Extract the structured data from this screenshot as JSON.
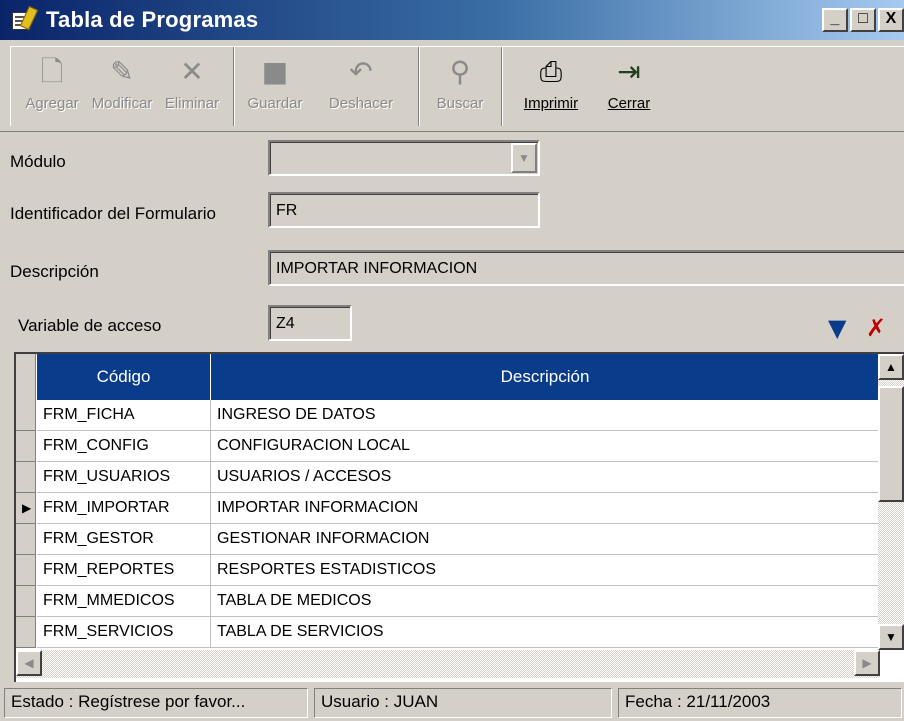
{
  "window": {
    "title": "Tabla de Programas",
    "controls": [
      "_",
      "□",
      "X"
    ]
  },
  "toolbar": {
    "agregar": "Agregar",
    "modificar": "Modificar",
    "eliminar": "Eliminar",
    "guardar": "Guardar",
    "deshacer": "Deshacer",
    "buscar": "Buscar",
    "imprimir": "Imprimir",
    "cerrar": "Cerrar"
  },
  "form": {
    "modulo_label": "Módulo",
    "modulo_value": "",
    "identificador_label": "Identificador del Formulario",
    "identificador_value": "FR",
    "descripcion_label": "Descripción",
    "descripcion_value": "IMPORTAR INFORMACION",
    "variable_label": "Variable de acceso",
    "variable_value": "Z4"
  },
  "grid": {
    "columns": [
      "Código",
      "Descripción"
    ],
    "current_row": 3,
    "rows": [
      [
        "FRM_FICHA",
        "INGRESO DE DATOS"
      ],
      [
        "FRM_CONFIG",
        "CONFIGURACION LOCAL"
      ],
      [
        "FRM_USUARIOS",
        "USUARIOS / ACCESOS"
      ],
      [
        "FRM_IMPORTAR",
        "IMPORTAR INFORMACION"
      ],
      [
        "FRM_GESTOR",
        "GESTIONAR INFORMACION"
      ],
      [
        "FRM_REPORTES",
        "RESPORTES ESTADISTICOS"
      ],
      [
        "FRM_MMEDICOS",
        "TABLA DE MEDICOS"
      ],
      [
        "FRM_SERVICIOS",
        "TABLA DE SERVICIOS"
      ]
    ]
  },
  "status": {
    "estado": "Estado   : Regístrese por favor...",
    "usuario": "Usuario  : JUAN",
    "fecha": "Fecha   : 21/11/2003"
  },
  "colors": {
    "grid_header": "#0a3c8c",
    "titlebar_start": "#0a246a"
  }
}
